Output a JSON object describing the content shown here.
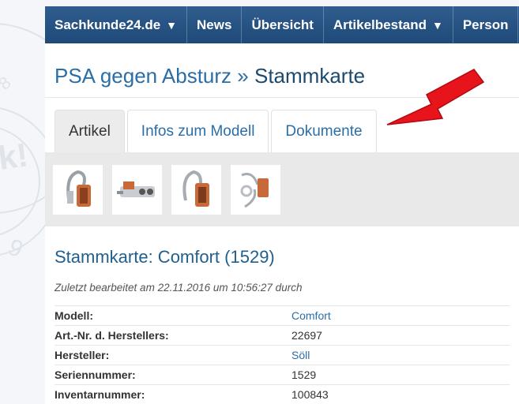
{
  "nav": {
    "items": [
      {
        "label": "Sachkunde24.de",
        "caret": "▼"
      },
      {
        "label": "News"
      },
      {
        "label": "Übersicht"
      },
      {
        "label": "Artikelbestand",
        "caret": "▼"
      },
      {
        "label": "Person"
      }
    ]
  },
  "breadcrumb": {
    "parent": "PSA gegen Absturz",
    "separator": "»",
    "current": "Stammkarte"
  },
  "tabs": [
    "Artikel",
    "Infos zum Modell",
    "Dokumente"
  ],
  "active_tab": "Artikel",
  "card": {
    "title": "Stammkarte: Comfort (1529)",
    "last_edited": "Zuletzt bearbeitet am 22.11.2016 um 10:56:27 durch"
  },
  "details": [
    {
      "label": "Modell:",
      "value": "Comfort",
      "link": true
    },
    {
      "label": "Art.-Nr. d. Herstellers:",
      "value": "22697",
      "link": false
    },
    {
      "label": "Hersteller:",
      "value": "Söll",
      "link": true
    },
    {
      "label": "Seriennummer:",
      "value": "1529",
      "link": false
    },
    {
      "label": "Inventarnummer:",
      "value": "100843",
      "link": false
    }
  ],
  "colors": {
    "nav_bg": "#2f5d8f",
    "link": "#2a6ea8",
    "arrow": "#e8141c"
  }
}
